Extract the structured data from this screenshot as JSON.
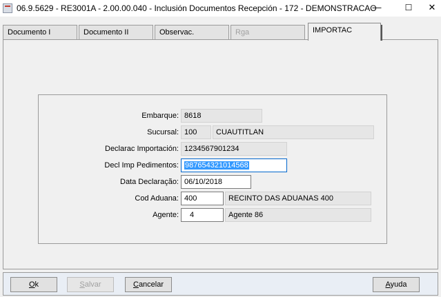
{
  "window": {
    "title": "06.9.5629 - RE3001A - 2.00.00.040 - Inclusión Documentos Recepción - 172 - DEMONSTRACAO",
    "minimize_glyph": "—",
    "maximize_glyph": "☐",
    "close_glyph": "✕"
  },
  "tabs": [
    {
      "label": "Documento  I",
      "state": "normal"
    },
    {
      "label": "Documento II",
      "state": "normal"
    },
    {
      "label": "Observac.",
      "state": "normal"
    },
    {
      "label": "Rga",
      "state": "disabled"
    },
    {
      "label": "IMPORTAC",
      "state": "active"
    }
  ],
  "form": {
    "embarque": {
      "label": "Embarque:",
      "value": "8618"
    },
    "sucursal": {
      "label": "Sucursal:",
      "code": "100",
      "name": "CUAUTITLAN"
    },
    "declarac_importacion": {
      "label": "Declarac Importación:",
      "value": "1234567901234"
    },
    "decl_imp_pedimentos": {
      "label": "Decl Imp Pedimentos:",
      "value": "987654321014568"
    },
    "data_declaracao": {
      "label": "Data Declaração:",
      "value": "06/10/2018"
    },
    "cod_aduana": {
      "label": "Cod Aduana:",
      "code": "400",
      "name": "RECINTO DAS ADUANAS 400"
    },
    "agente": {
      "label": "Agente:",
      "code": "4",
      "name": "Agente 86"
    }
  },
  "buttons": {
    "ok": {
      "label_u": "O",
      "label_rest": "k"
    },
    "salvar": {
      "label_u": "S",
      "label_rest": "alvar",
      "disabled": true
    },
    "cancelar": {
      "label_u": "C",
      "label_rest": "ancelar"
    },
    "ayuda": {
      "label_u": "A",
      "label_rest": "yuda"
    }
  },
  "colors": {
    "window_bg": "#f0f0f0",
    "selection": "#3399ff",
    "focus_border": "#0066cc",
    "bottom_bar": "#e9eef5"
  }
}
